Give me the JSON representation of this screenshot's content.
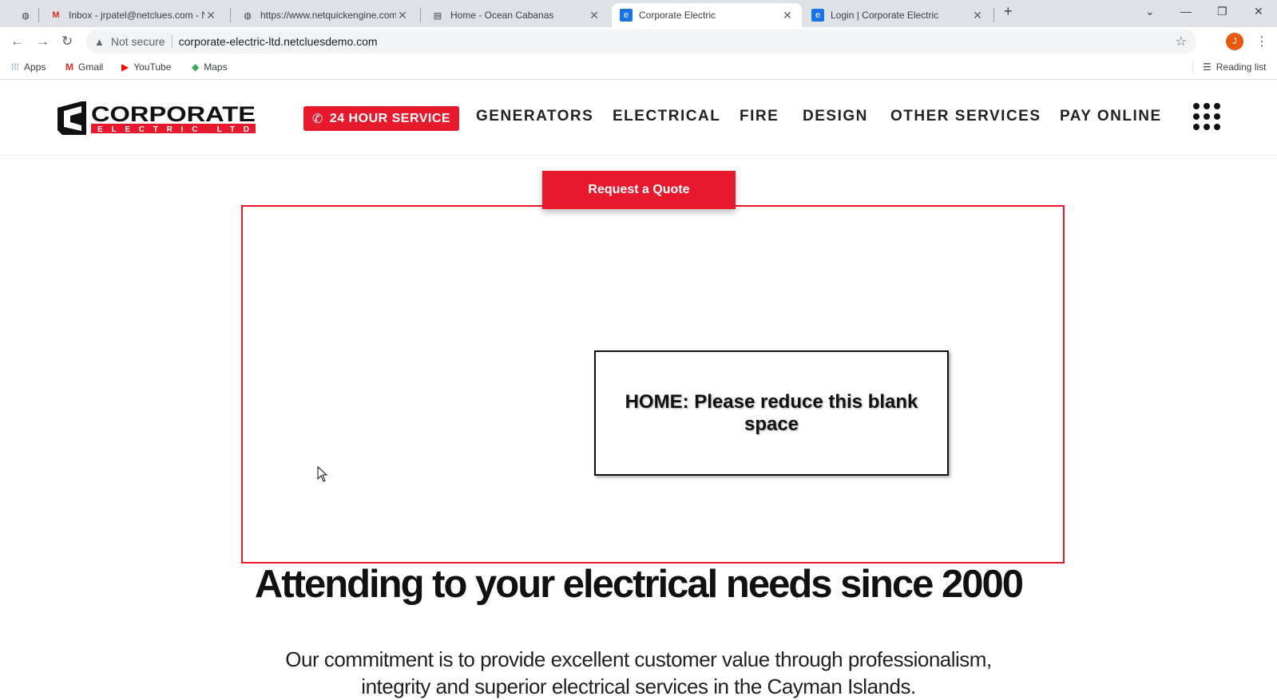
{
  "browser": {
    "tabs": [
      {
        "title": "",
        "icon": "globe-icon"
      },
      {
        "title": "Inbox - jrpatel@netclues.com - N",
        "icon": "gmail-icon"
      },
      {
        "title": "https://www.netquickengine.com",
        "icon": "globe-icon"
      },
      {
        "title": "Home - Ocean Cabanas",
        "icon": "page-icon"
      },
      {
        "title": "Corporate Electric",
        "icon": "corporate-electric-icon",
        "active": true
      },
      {
        "title": "Login | Corporate Electric",
        "icon": "corporate-electric-icon"
      }
    ],
    "new_tab": "+",
    "address": {
      "security": "Not secure",
      "url": "corporate-electric-ltd.netcluesdemo.com"
    },
    "profile_initial": "J",
    "bookmarks": [
      {
        "label": "Apps",
        "icon": "apps-grid-icon"
      },
      {
        "label": "Gmail",
        "icon": "gmail-icon"
      },
      {
        "label": "YouTube",
        "icon": "youtube-icon"
      },
      {
        "label": "Maps",
        "icon": "maps-icon"
      }
    ],
    "reading_list": "Reading list"
  },
  "site": {
    "logo": {
      "line1": "CORPORATE",
      "line2": "ELECTRIC LTD"
    },
    "service_button": "24 HOUR SERVICE",
    "menu": [
      "GENERATORS",
      "ELECTRICAL",
      "FIRE",
      "DESIGN",
      "OTHER SERVICES",
      "PAY ONLINE"
    ],
    "quote_button": "Request a Quote",
    "annotation": "HOME: Please reduce this blank space",
    "headline": "Attending to your electrical needs since 2000",
    "subtext_line1": "Our commitment is to provide excellent customer value through professionalism,",
    "subtext_line2": "integrity and superior electrical services in the Cayman Islands."
  },
  "colors": {
    "brand_red": "#e8192c",
    "text_dark": "#111111"
  }
}
